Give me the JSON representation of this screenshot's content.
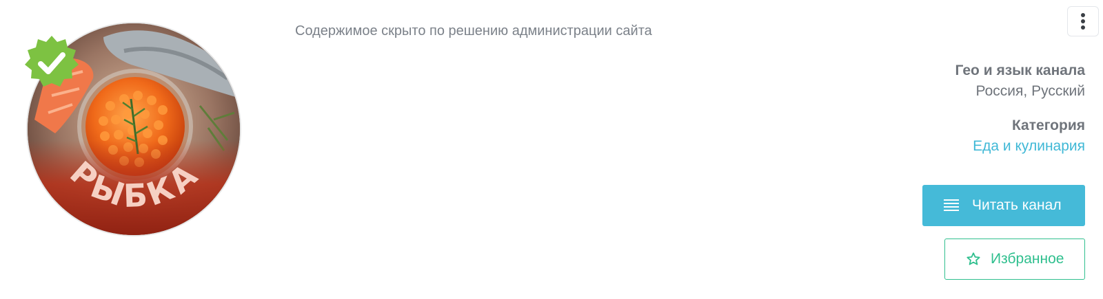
{
  "channel": {
    "avatar_text": "РЫБКА",
    "verified": true
  },
  "description": "Содержимое скрыто по решению администрации сайта",
  "info": {
    "geo_label": "Гео и язык канала",
    "geo_value": "Россия, Русский",
    "category_label": "Категория",
    "category_value": "Еда и кулинария"
  },
  "actions": {
    "read_label": "Читать канал",
    "favorite_label": "Избранное"
  },
  "colors": {
    "accent_blue": "#45bad8",
    "link": "#3fb8d6",
    "favorite_green": "#2fbf8e",
    "verified_green": "#7dc242",
    "text_gray": "#6f747b"
  },
  "icons": {
    "menu": "kebab-vertical-icon",
    "read": "lines-icon",
    "favorite": "star-outline-icon",
    "verified": "check-badge-icon"
  }
}
